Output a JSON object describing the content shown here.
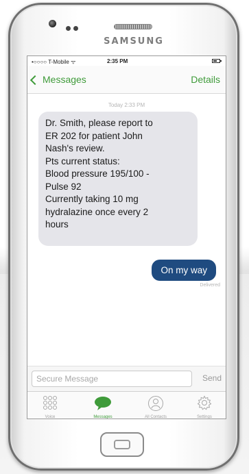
{
  "device": {
    "brand": "SAMSUNG"
  },
  "status_bar": {
    "carrier": "•○○○○ T-Mobile ᯤ",
    "time": "2:35 PM"
  },
  "nav": {
    "back_label": "Messages",
    "details_label": "Details"
  },
  "conversation": {
    "timestamp": "Today 2:33 PM",
    "incoming": {
      "lines": [
        "Dr. Smith, please report to",
        "ER 202 for patient John",
        "Nash's review.",
        "Pts current status:",
        "Blood pressure 195/100 -",
        "Pulse 92",
        "Currently taking 10 mg",
        "hydralazine once every 2",
        "hours"
      ]
    },
    "outgoing": {
      "text": "On my way",
      "status": "Delivered"
    }
  },
  "compose": {
    "placeholder": "Secure Message",
    "send_label": "Send"
  },
  "tabs": [
    {
      "label": "Voice",
      "icon": "keypad-icon",
      "active": false
    },
    {
      "label": "Messages",
      "icon": "chat-bubble-icon",
      "active": true
    },
    {
      "label": "All Contacts",
      "icon": "contacts-icon",
      "active": false
    },
    {
      "label": "Settings",
      "icon": "gear-icon",
      "active": false
    }
  ],
  "colors": {
    "accent": "#3f9b3a",
    "outgoing_bubble": "#1f4b80",
    "incoming_bubble": "#e5e5ea"
  }
}
